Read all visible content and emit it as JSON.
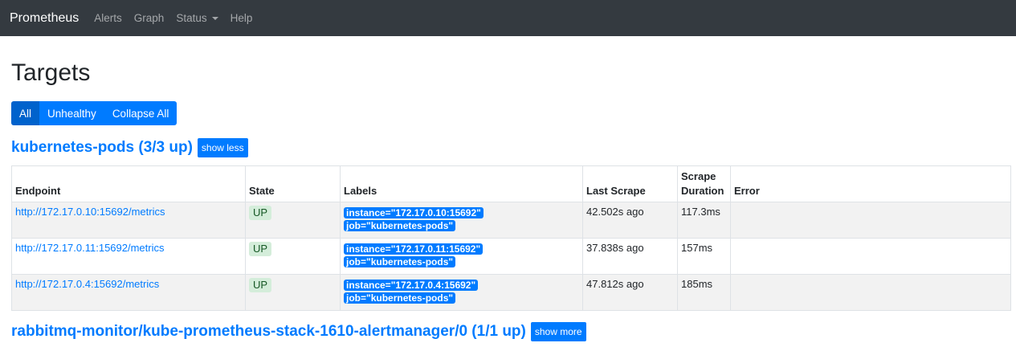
{
  "navbar": {
    "brand": "Prometheus",
    "items": [
      {
        "label": "Alerts"
      },
      {
        "label": "Graph"
      },
      {
        "label": "Status"
      },
      {
        "label": "Help"
      }
    ]
  },
  "page": {
    "title": "Targets",
    "filter_buttons": [
      "All",
      "Unhealthy",
      "Collapse All"
    ],
    "active_filter": "All"
  },
  "jobs": [
    {
      "title": "kubernetes-pods (3/3 up)",
      "toggle_label": "show less",
      "columns": [
        "Endpoint",
        "State",
        "Labels",
        "Last Scrape",
        "Scrape Duration",
        "Error"
      ],
      "rows": [
        {
          "endpoint": "http://172.17.0.10:15692/metrics",
          "state": "UP",
          "labels": [
            "instance=\"172.17.0.10:15692\"",
            "job=\"kubernetes-pods\""
          ],
          "last_scrape": "42.502s ago",
          "duration": "117.3ms",
          "error": ""
        },
        {
          "endpoint": "http://172.17.0.11:15692/metrics",
          "state": "UP",
          "labels": [
            "instance=\"172.17.0.11:15692\"",
            "job=\"kubernetes-pods\""
          ],
          "last_scrape": "37.838s ago",
          "duration": "157ms",
          "error": ""
        },
        {
          "endpoint": "http://172.17.0.4:15692/metrics",
          "state": "UP",
          "labels": [
            "instance=\"172.17.0.4:15692\"",
            "job=\"kubernetes-pods\""
          ],
          "last_scrape": "47.812s ago",
          "duration": "185ms",
          "error": ""
        }
      ]
    },
    {
      "title": "rabbitmq-monitor/kube-prometheus-stack-1610-alertmanager/0 (1/1 up)",
      "toggle_label": "show more"
    }
  ],
  "colors": {
    "navbar_bg": "#343a40",
    "primary": "#007bff",
    "active_button": "#0062cc",
    "up_badge_bg": "#d4edda",
    "up_badge_text": "#155724"
  }
}
